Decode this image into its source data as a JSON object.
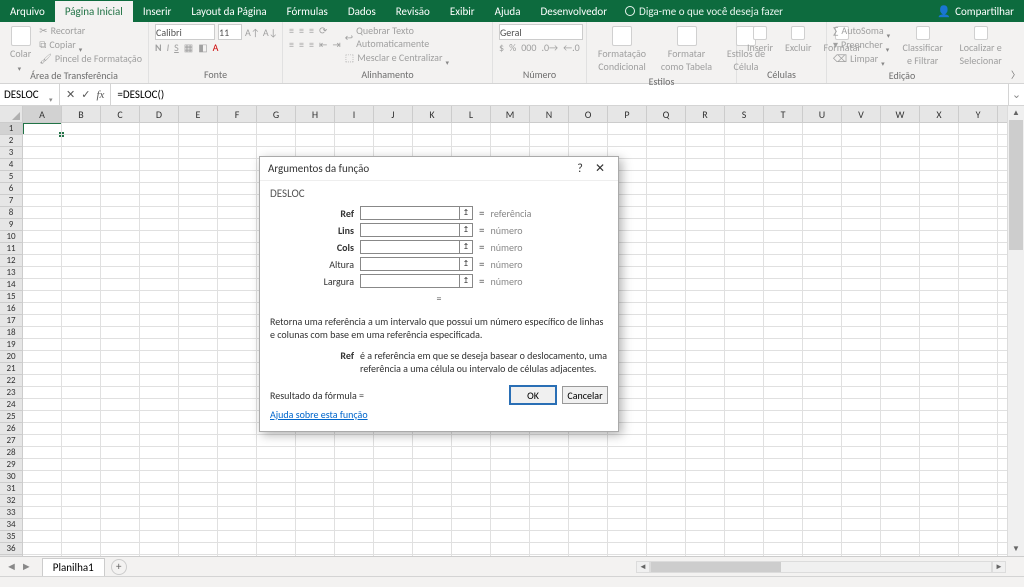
{
  "titlebar": {
    "tabs": [
      "Arquivo",
      "Página Inicial",
      "Inserir",
      "Layout da Página",
      "Fórmulas",
      "Dados",
      "Revisão",
      "Exibir",
      "Ajuda",
      "Desenvolvedor"
    ],
    "active_tab_index": 1,
    "tell_me": "Diga-me o que você deseja fazer",
    "share": "Compartilhar"
  },
  "ribbon": {
    "clipboard": {
      "paste": "Colar",
      "cut": "Recortar",
      "copy": "Copiar",
      "format_painter": "Pincel de Formatação",
      "title": "Área de Transferência"
    },
    "font": {
      "family": "Calibri",
      "size": "11",
      "title": "Fonte"
    },
    "alignment": {
      "wrap": "Quebrar Texto Automaticamente",
      "merge": "Mesclar e Centralizar",
      "title": "Alinhamento"
    },
    "number": {
      "format": "Geral",
      "title": "Número"
    },
    "styles": {
      "cond": "Formatação Condicional",
      "table": "Formatar como Tabela",
      "cell": "Estilos de Célula",
      "title": "Estilos"
    },
    "cells": {
      "insert": "Inserir",
      "delete": "Excluir",
      "format": "Formatar",
      "title": "Células"
    },
    "editing": {
      "sum": "AutoSoma",
      "fill": "Preencher",
      "clear": "Limpar",
      "sort": "Classificar e Filtrar",
      "find": "Localizar e Selecionar",
      "title": "Edição"
    }
  },
  "formula_bar": {
    "name_box": "DESLOC",
    "formula": "=DESLOC()"
  },
  "columns": [
    "A",
    "B",
    "C",
    "D",
    "E",
    "F",
    "G",
    "H",
    "I",
    "J",
    "K",
    "L",
    "M",
    "N",
    "O",
    "P",
    "Q",
    "R",
    "S",
    "T",
    "U",
    "V",
    "W",
    "X",
    "Y"
  ],
  "active_col_index": 0,
  "row_count": 37,
  "active_row": 1,
  "sheet_tab": "Planilha1",
  "dialog": {
    "title": "Argumentos da função",
    "fn": "DESLOC",
    "args": [
      {
        "label": "Ref",
        "bold": true,
        "hint": "referência"
      },
      {
        "label": "Lins",
        "bold": true,
        "hint": "número"
      },
      {
        "label": "Cols",
        "bold": true,
        "hint": "número"
      },
      {
        "label": "Altura",
        "bold": false,
        "hint": "número"
      },
      {
        "label": "Largura",
        "bold": false,
        "hint": "número"
      }
    ],
    "desc": "Retorna uma referência a um intervalo que possui um número específico de linhas e colunas com base em uma referência especificada.",
    "arg_focus_label": "Ref",
    "arg_focus_text": "é a referência em que se deseja basear o deslocamento, uma referência a uma célula ou intervalo de células adjacentes.",
    "result_label": "Resultado da fórmula =",
    "help_link": "Ajuda sobre esta função",
    "ok": "OK",
    "cancel": "Cancelar"
  }
}
